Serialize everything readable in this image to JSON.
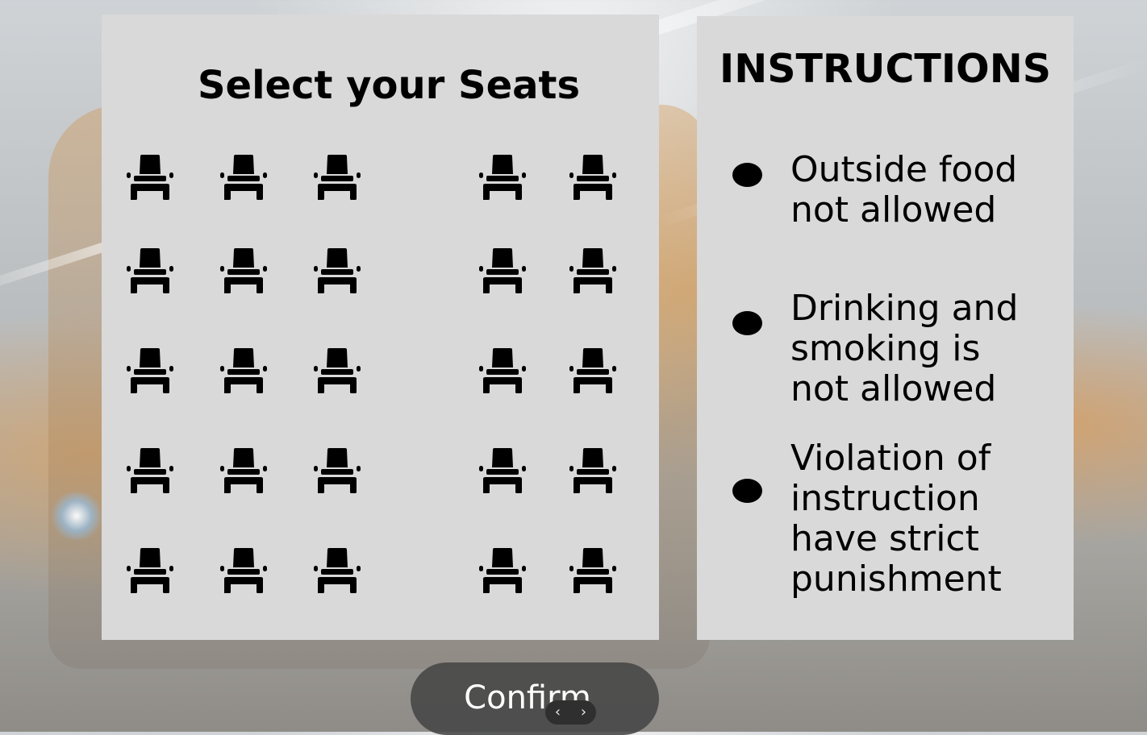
{
  "seat_selection": {
    "title": "Select your Seats",
    "seats_per_row": 5,
    "row_count": 5,
    "seat_icon": "armchair-icon"
  },
  "instructions": {
    "title": "INSTRUCTIONS",
    "rules": [
      "Outside food\n not allowed",
      "Drinking and\nsmoking is\nnot allowed",
      "Violation of\ninstruction\nhave strict\npunishment"
    ],
    "bullet_icon": "bullet-icon"
  },
  "actions": {
    "confirm_label": "Confirm"
  },
  "pager": {
    "prev_label": "‹",
    "next_label": "›"
  },
  "colors": {
    "panel": "#d9d9d9",
    "text": "#000000",
    "button": "#464646",
    "button_text": "#ffffff"
  }
}
